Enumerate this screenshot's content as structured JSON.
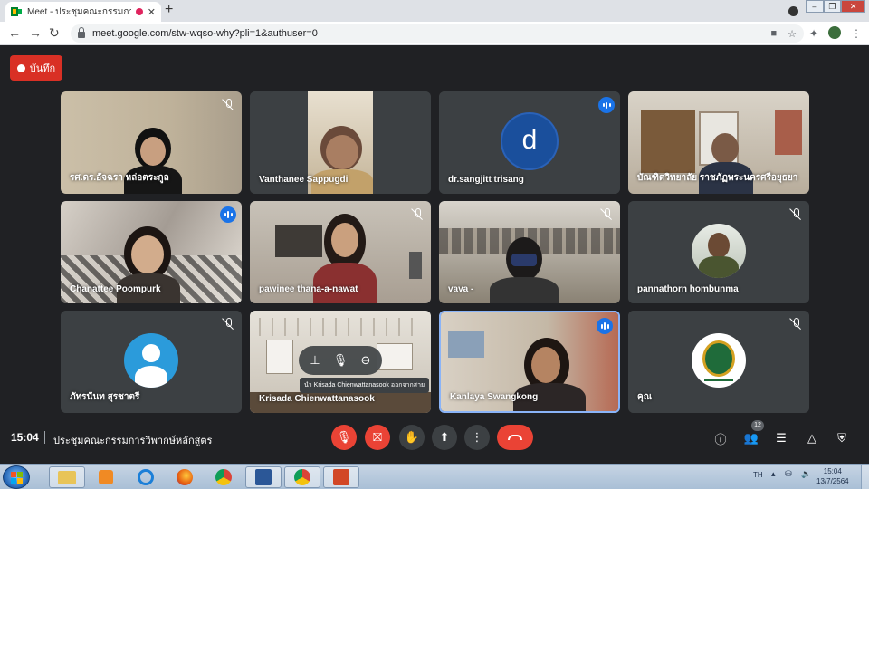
{
  "browser": {
    "tab_title": "Meet - ประชุมคณะกรรมการวิพากษ์",
    "new_tab_label": "+",
    "url": "meet.google.com/stw-wqso-why?pli=1&authuser=0"
  },
  "meet": {
    "record_label": "บันทึก",
    "time": "15:04",
    "meeting_name": "ประชุมคณะกรรมการวิพากษ์หลักสูตร",
    "people_count": "12",
    "tooltip": "นำ Krisada Chienwattanasook ออกจากสาย",
    "tiles": [
      {
        "name": "รศ.ดร.อัจฉรา หล่อตระกูล",
        "status": "muted"
      },
      {
        "name": "Vanthanee Sappugdi",
        "status": "none"
      },
      {
        "name": "dr.sangjitt trisang",
        "status": "speaking",
        "avatar_letter": "d"
      },
      {
        "name": "บัณฑิตวิทยาลัย ราชภัฏพระนครศรีอยุธยา",
        "status": "none"
      },
      {
        "name": "Chanattee Poompurk",
        "status": "speaking"
      },
      {
        "name": "pawinee thana-a-nawat",
        "status": "muted"
      },
      {
        "name": "vava -",
        "status": "muted"
      },
      {
        "name": "pannathorn hombunma",
        "status": "muted"
      },
      {
        "name": "ภัทรนันท สุรชาตรี",
        "status": "muted"
      },
      {
        "name": "Krisada Chienwattanasook",
        "status": "none"
      },
      {
        "name": "Kanlaya Swangkong",
        "status": "speaking",
        "active": true
      },
      {
        "name": "คุณ",
        "status": "muted"
      }
    ]
  },
  "taskbar": {
    "language": "TH",
    "clock_time": "15:04",
    "clock_date": "13/7/2564"
  },
  "colors": {
    "meet_bg": "#202124",
    "tile_bg": "#3c4043",
    "danger": "#ea4335",
    "speaking_blue": "#1a73e8",
    "avatar_d": "#1a4f9c"
  }
}
